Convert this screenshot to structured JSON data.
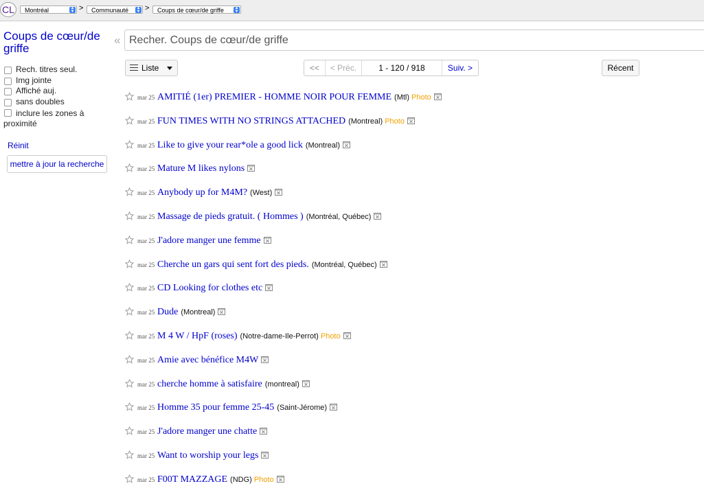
{
  "header": {
    "logo": "CL",
    "breadcrumb": [
      {
        "label": "Montréal"
      },
      {
        "label": "Communauté"
      },
      {
        "label": "Coups de cœur/de griffe"
      }
    ],
    "separator": ">"
  },
  "sidebar": {
    "title": "Coups de cœur/de griffe",
    "filters": [
      {
        "label": "Rech. titres seul.",
        "checked": false
      },
      {
        "label": "Img jointe",
        "checked": false
      },
      {
        "label": "Affiché auj.",
        "checked": false
      },
      {
        "label": "sans doubles",
        "checked": false
      },
      {
        "label": "inclure les zones à proximité",
        "checked": false
      }
    ],
    "reset_label": "Réinit",
    "update_label": "mettre à jour la recherche"
  },
  "search": {
    "placeholder": "Recher. Coups de cœur/de griffe"
  },
  "toolbar": {
    "view_label": "Liste",
    "first_label": "<<",
    "prev_label": "< Préc.",
    "range_label": "1 - 120 / 918",
    "next_label": "Suiv. >",
    "sort_label": "Récent"
  },
  "colors": {
    "link": "#0000cc",
    "photo_tag": "#f0a000",
    "topbar": "#eeeeee"
  },
  "results": [
    {
      "date": "mar 25",
      "title": "AMITIÉ (1er) PREMIER - HOMME NOIR POUR FEMME",
      "hood": "(Mtl)",
      "tag": "Photo"
    },
    {
      "date": "mar 25",
      "title": "FUN TIMES WITH NO STRINGS ATTACHED",
      "hood": "(Montreal)",
      "tag": "Photo"
    },
    {
      "date": "mar 25",
      "title": "Like to give your rear*ole a good lick",
      "hood": "(Montreal)",
      "tag": ""
    },
    {
      "date": "mar 25",
      "title": "Mature M likes nylons",
      "hood": "",
      "tag": ""
    },
    {
      "date": "mar 25",
      "title": "Anybody up for M4M?",
      "hood": "(West)",
      "tag": ""
    },
    {
      "date": "mar 25",
      "title": "Massage de pieds gratuit. ( Hommes )",
      "hood": "(Montréal, Québec)",
      "tag": ""
    },
    {
      "date": "mar 25",
      "title": "J'adore manger une femme",
      "hood": "",
      "tag": ""
    },
    {
      "date": "mar 25",
      "title": "Cherche un gars qui sent fort des pieds.",
      "hood": "(Montréal, Québec)",
      "tag": ""
    },
    {
      "date": "mar 25",
      "title": "CD Looking for clothes etc",
      "hood": "",
      "tag": ""
    },
    {
      "date": "mar 25",
      "title": "Dude",
      "hood": "(Montreal)",
      "tag": ""
    },
    {
      "date": "mar 25",
      "title": "M 4 W / HpF (roses)",
      "hood": "(Notre-dame-Ile-Perrot)",
      "tag": "Photo"
    },
    {
      "date": "mar 25",
      "title": "Amie avec bénéfice M4W",
      "hood": "",
      "tag": ""
    },
    {
      "date": "mar 25",
      "title": "cherche homme à satisfaire",
      "hood": "(montreal)",
      "tag": ""
    },
    {
      "date": "mar 25",
      "title": "Homme 35 pour femme 25-45",
      "hood": "(Saint-Jérome)",
      "tag": ""
    },
    {
      "date": "mar 25",
      "title": "J'adore manger une chatte",
      "hood": "",
      "tag": ""
    },
    {
      "date": "mar 25",
      "title": "Want to worship your legs",
      "hood": "",
      "tag": ""
    },
    {
      "date": "mar 25",
      "title": "F00T MAZZAGE",
      "hood": "(NDG)",
      "tag": "Photo"
    }
  ]
}
